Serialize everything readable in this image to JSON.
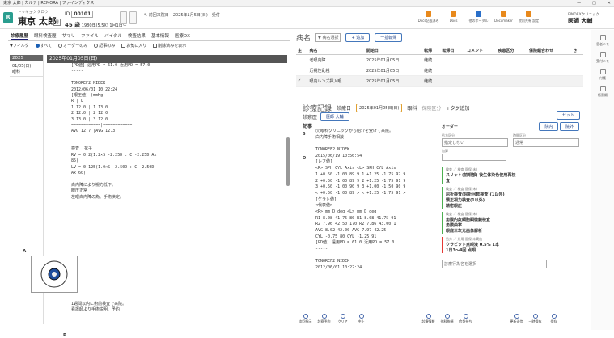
{
  "window": {
    "title": "東京 太郎 | カルテ | REMORA | ファインディクス",
    "controls": [
      "—",
      "□",
      "✕"
    ]
  },
  "patient": {
    "kana": "トウキョウ タロウ",
    "number_label": "ID",
    "id": "00101",
    "name": "東京 太郎",
    "sex": "男",
    "age": "45 歳",
    "birth": "1980年(5.5X) 1月1日生"
  },
  "visit": {
    "label": "前回来院日",
    "date": "2025年1月5日(日)",
    "note": "受付"
  },
  "apps": [
    {
      "label": "Docs記載済み",
      "color": "#e8891c"
    },
    {
      "label": "Docs",
      "color": "#e8891c"
    },
    {
      "label": "他のポータル",
      "color": "#2a6fc9"
    },
    {
      "label": "Documaker",
      "color": "#e8891c"
    },
    {
      "label": "院内共有 設定",
      "color": "#e8891c"
    }
  ],
  "clinic": {
    "name": "FINDEXクリニック",
    "doctor": "医師 大輔"
  },
  "rail": [
    "患者メモ",
    "受付メモ",
    "付箋",
    "帳票類"
  ],
  "left": {
    "tabs": [
      "診療履歴",
      "眼科検査歴",
      "サマリ",
      "ファイル",
      "バイタル",
      "検査結果",
      "基本情報",
      "医療DX"
    ],
    "filters": {
      "filter": "フィルタ",
      "all": "すべて",
      "order_only": "オーダーのみ",
      "record_only": "記事のみ",
      "favorite": "お気に入り",
      "show_deleted": "削除済みを表示"
    },
    "year": "2025",
    "dates": [
      {
        "date": "01/05(日)",
        "dept": "眼科"
      }
    ],
    "record_header": "2025年01月05日(日)",
    "record_lines": [
      "[PD値] 遠用PD = 61.0 近用PD = 57.0",
      "-----",
      "",
      "TONOREF2 NIDEK",
      "2012/06/01 10:22:24",
      "[眼圧値] (mmHg)",
      "R | L",
      "1 12.0 | 1 13.0",
      "2 12.0 | 2 12.0",
      "3 13.0 | 3 12.0",
      "============|============",
      "AVG 12.7 |AVG 12.3",
      "-----",
      "",
      "検査  花子",
      "RV = 0.2(1.2×S -2.25D : C -2.25D Ax",
      "85)",
      "LV = 0.125(1.0×S -2.50D : C -2.50D",
      "Ax 60)",
      "",
      "白内障により視力低下。",
      "眼圧正常",
      "左眼白内障の為、手術決定。"
    ],
    "assessment_label": "A",
    "plan_label": "P",
    "plan_lines": [
      "1週間以内に術前検査で来院。",
      "看護師より手術説明、予約"
    ]
  },
  "disease": {
    "title": "病名",
    "select_placeholder": "病名選択",
    "add_button": "+ 追加",
    "bulk_button": "一括転帰",
    "columns": [
      "主",
      "病名",
      "開始日",
      "転帰",
      "転帰日",
      "コメント",
      "疾患区分",
      "保険組合わせ",
      "き"
    ],
    "rows": [
      {
        "main": "",
        "name": "老眼内障",
        "start": "2025年01月05日",
        "outcome": "継続"
      },
      {
        "main": "",
        "name": "近視性乱視",
        "start": "2025年01月05日",
        "outcome": "継続"
      },
      {
        "main": "✓",
        "name": "眼内レンズ挿入眼",
        "start": "2025年01月05日",
        "outcome": "継続"
      }
    ]
  },
  "record": {
    "title": "診療記録",
    "date_label": "診療日",
    "date": "2025年01月05日(日)",
    "dept": "眼科",
    "insurance": "保険区分",
    "tag_add": "+タグ追加",
    "staff_label": "診察医",
    "staff": "医師 大輔",
    "set_button": "セット",
    "notes_title": "記事",
    "orders_title": "オーダー",
    "order_actions": [
      "院内",
      "院外"
    ],
    "prescription_label": "処方区分",
    "prescription_value": "指定しない",
    "timing_label": "時間区分",
    "timing_value": "通常",
    "dept_label": "加算",
    "s_label": "S",
    "o_label": "O",
    "s_lines": [
      "○○眼科クリニックから紹介を受けて来院。",
      "白内障手術相談"
    ],
    "o_lines": [
      "TONOREF2 NIDEK",
      "2015/06/19 10:56:54",
      "[レフ値]",
      "<R> SPH CYL Axis <L> SPH CYL Axis",
      "1 +0.50 -1.00 89 9 1 +1.25 -1.75 92 9",
      "2 +0.50 -1.00 89 9 2 +1.25 -1.75 91 9",
      "3 +0.50 -1.00 90 9 3 +1.00 -1.50 90 9",
      "< +0.50 -1.00 89 > < +1.25 -1.75 91 >",
      "[ケラト値]",
      "<代表値>",
      "<R> mm D deg <L> mm D deg",
      "R1 8.08 41.75 80 R1 8.08 41.75 91",
      "R2 7.96 42.50 170 R2 7.86 43.00 1",
      "AVG 8.02 42.00 AVG 7.97 42.25",
      "CYL -0.75 80 CYL -1.25 91",
      "[PD値] 遠用PD = 61.0 近用PD = 57.0",
      "-----",
      "",
      "TONOREF2 NIDEK",
      "2012/06/01 10:22:24"
    ],
    "orders": [
      {
        "head": "検査 ／ 検査 医保(未)",
        "lines": [
          "スリット(前眼部) 後生体染色使用再検",
          "査"
        ],
        "red": false
      },
      {
        "head": "検査 ／ 検査 医保(未)",
        "lines": [
          "屈折検査(屈折回数検査)(1以外)",
          "矯正視力検査(1以外)",
          "精密眼圧"
        ],
        "red": false
      },
      {
        "head": "検査 ／ 検査 医保(未)",
        "lines": [
          "角膜内皮細胞顕微鏡検査",
          "角膜曲率",
          "眼底三次元画像解析"
        ],
        "red": false
      },
      {
        "head": "処方 ／ 外用 医保 未実施",
        "lines": [
          "クラビット点眼液 0.5%  1本",
          "1日3～4回 点眼"
        ],
        "red": true
      }
    ],
    "order_select_placeholder": "診療行為名を選択"
  },
  "bottom": [
    "次回指示",
    "診察予約",
    "クリア",
    "中止",
    "診療情報",
    "他科依頼",
    "会計待ち",
    "更新送信",
    "一時保存",
    "保存"
  ]
}
